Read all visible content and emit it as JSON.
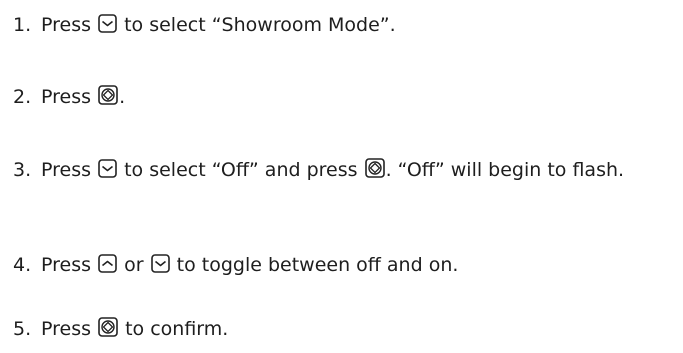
{
  "steps": [
    {
      "number": "1.",
      "parts": {
        "a": "Press",
        "b": "to select “Showroom Mode”."
      },
      "icons": [
        "down-button-icon"
      ]
    },
    {
      "number": "2.",
      "parts": {
        "a": "Press",
        "b": "."
      },
      "icons": [
        "select-button-icon"
      ]
    },
    {
      "number": "3.",
      "parts": {
        "a": "Press",
        "b": "to select “Off” and press",
        "c": ". “Off” will begin to flash."
      },
      "icons": [
        "down-button-icon",
        "select-button-icon"
      ]
    },
    {
      "number": "4.",
      "parts": {
        "a": "Press",
        "b": "or",
        "c": "to toggle between off and on."
      },
      "icons": [
        "up-button-icon",
        "down-button-icon"
      ]
    },
    {
      "number": "5.",
      "parts": {
        "a": "Press",
        "b": "to confirm."
      },
      "icons": [
        "select-button-icon"
      ]
    }
  ]
}
